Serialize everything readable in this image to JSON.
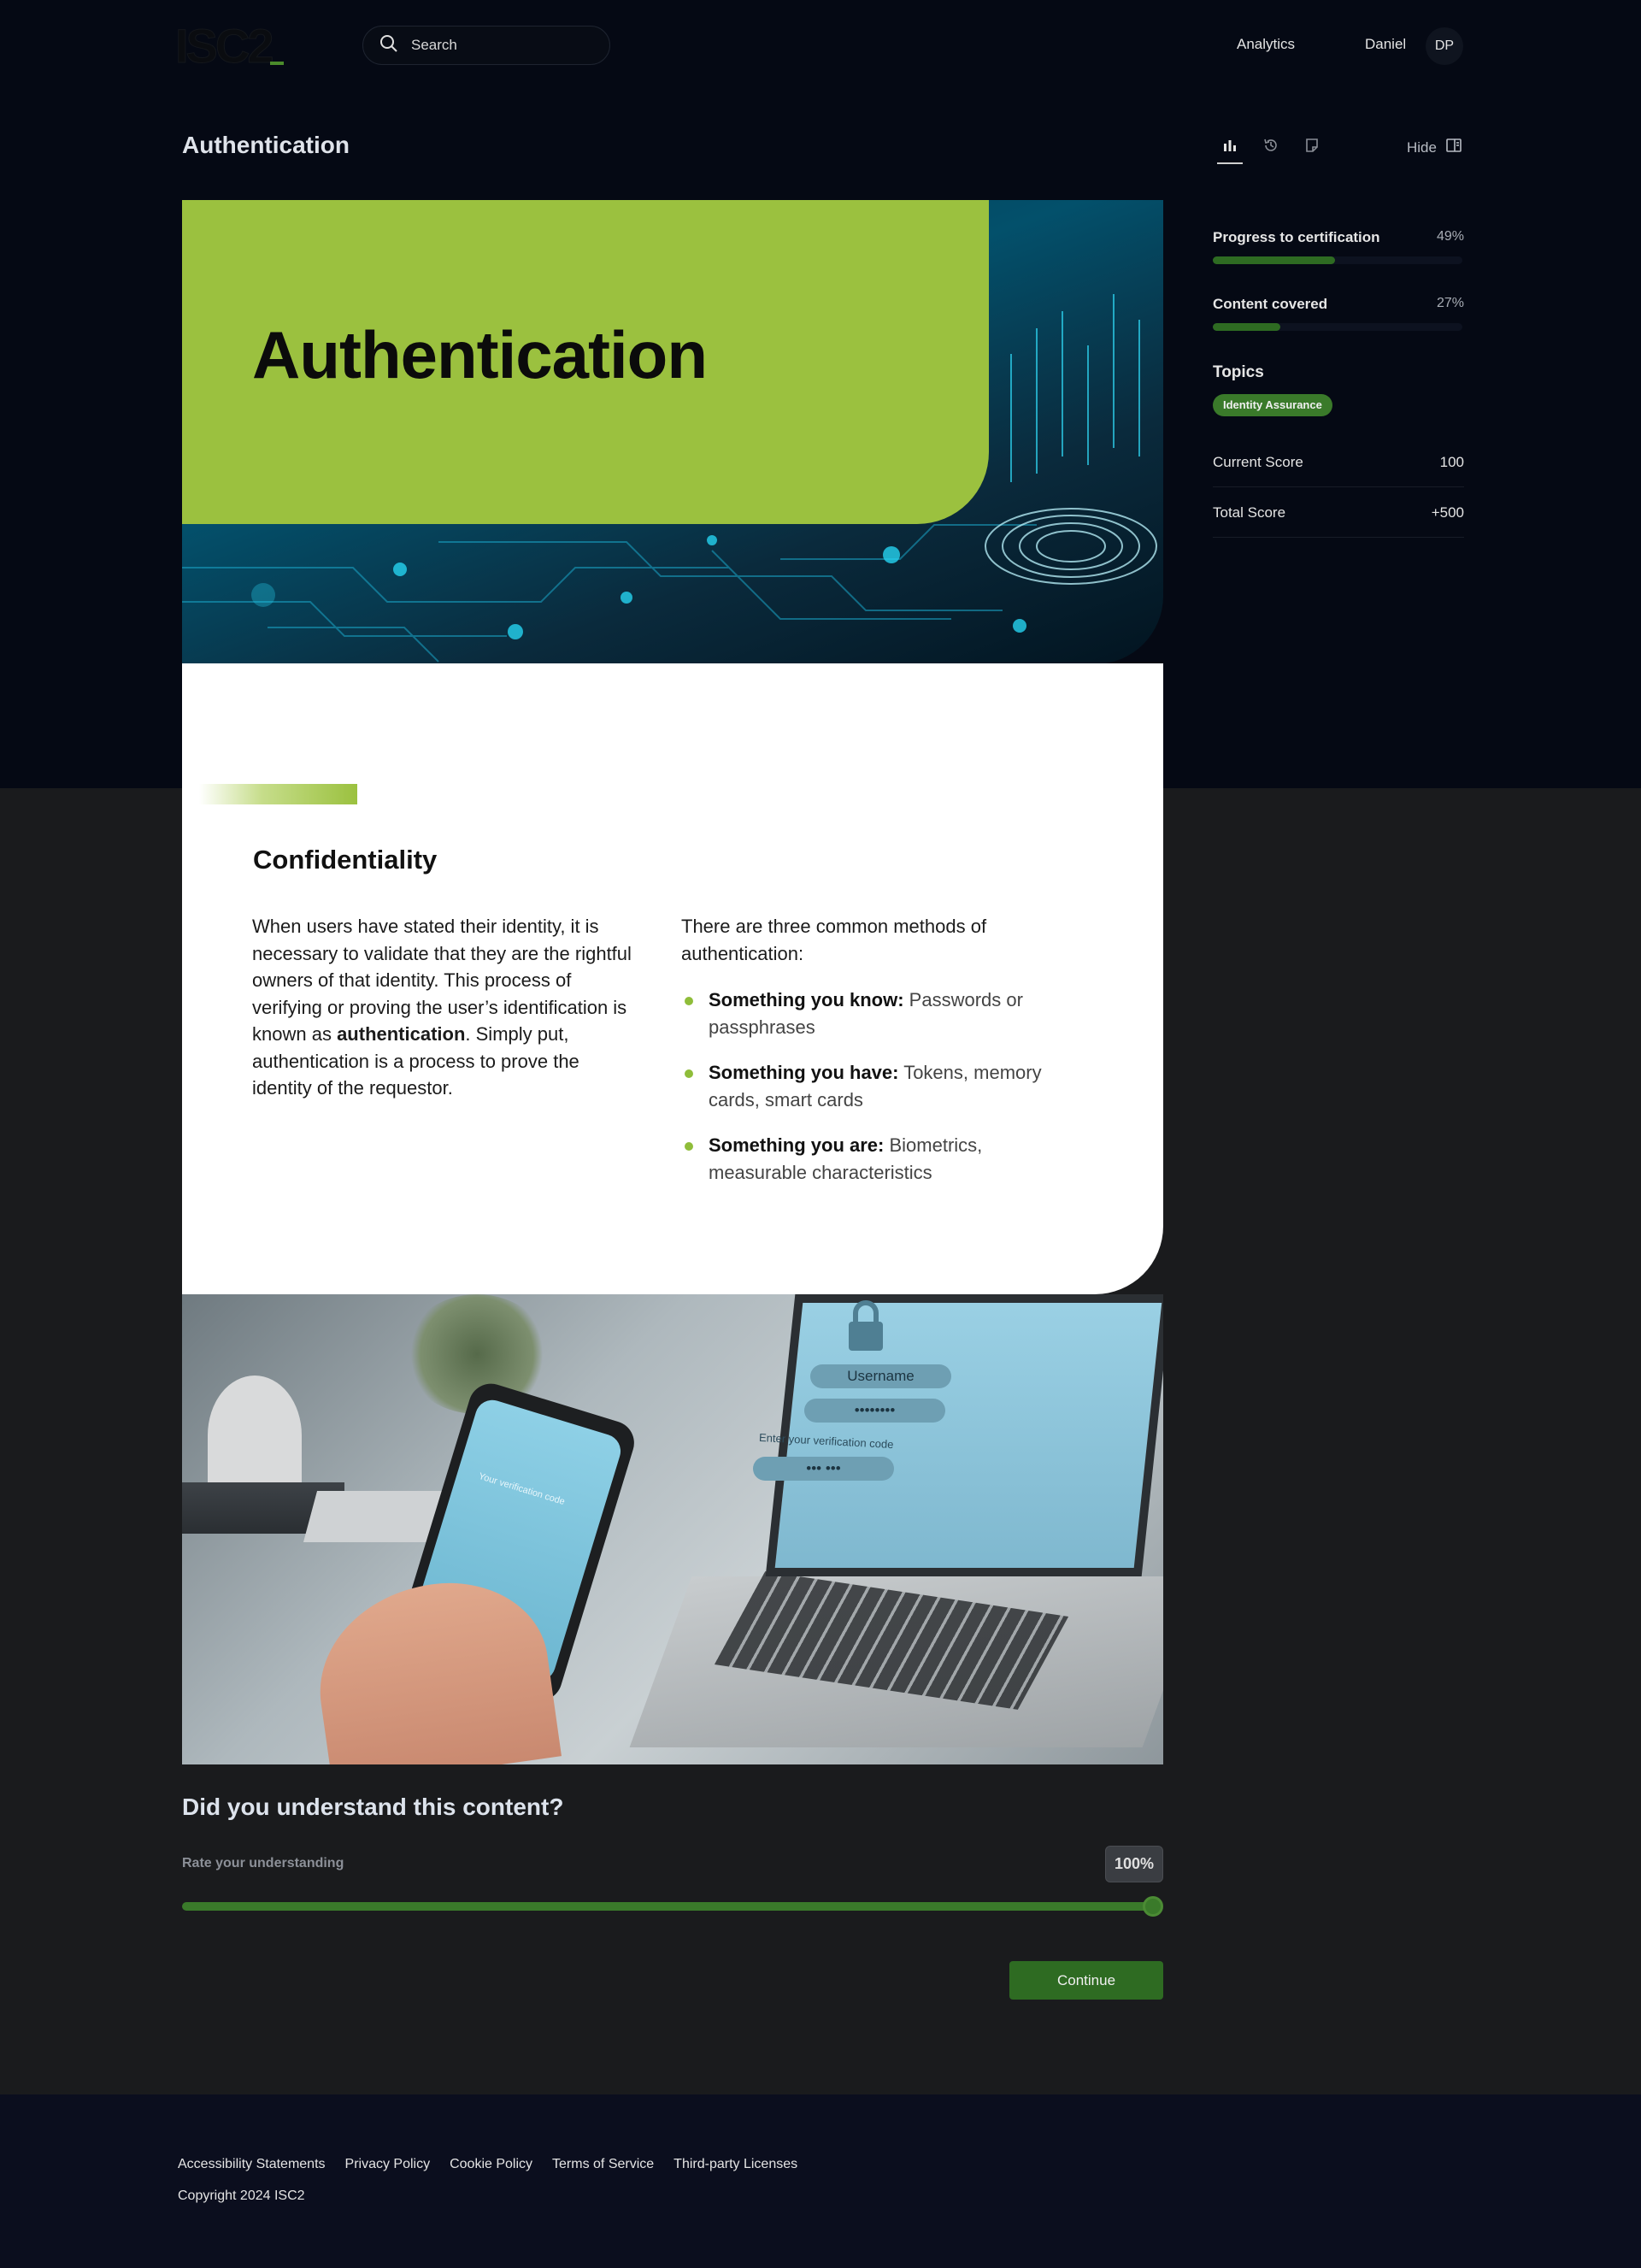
{
  "header": {
    "logo": "ISC2",
    "search_placeholder": "Search",
    "nav_analytics": "Analytics",
    "user_name": "Daniel",
    "user_initials": "DP"
  },
  "page": {
    "title": "Authentication",
    "hide_label": "Hide"
  },
  "sidebar": {
    "progress_label": "Progress to certification",
    "progress_value": "49%",
    "progress_fraction": 0.49,
    "content_label": "Content covered",
    "content_value": "27%",
    "content_fraction": 0.27,
    "topics_title": "Topics",
    "topic_chip": "Identity Assurance",
    "current_score_label": "Current Score",
    "current_score_value": "100",
    "total_score_label": "Total Score",
    "total_score_value": "+500"
  },
  "hero": {
    "title": "Authentication"
  },
  "content": {
    "section_title": "Confidentiality",
    "left_text_before": "When users have stated their identity, it is necessary to validate that they are the rightful owners of that identity. This process of verifying or proving the user’s identification is known as ",
    "left_text_bold": "authentication",
    "left_text_after": ". Simply put, authentication is a process to prove the identity of the requestor.",
    "right_intro": "There are three common methods of authentication:",
    "methods": [
      {
        "bold": "Something you know:",
        "text": " Passwords or passphrases"
      },
      {
        "bold": "Something you have:",
        "text": " Tokens, memory cards, smart cards"
      },
      {
        "bold": "Something you are:",
        "text": " Biometrics, measurable characteristics"
      }
    ]
  },
  "photo": {
    "username_field": "Username",
    "password_field": "••••••••",
    "verification_caption": "Enter your verification code",
    "code_field": "•••  •••",
    "phone_text": "Your verification code"
  },
  "rating": {
    "title": "Did you understand this content?",
    "label": "Rate your understanding",
    "value_text": "100%",
    "value_fraction": 1.0,
    "continue_label": "Continue"
  },
  "footer": {
    "links": [
      "Accessibility Statements",
      "Privacy Policy",
      "Cookie Policy",
      "Terms of Service",
      "Third-party Licenses"
    ],
    "copyright": "Copyright 2024 ISC2"
  },
  "colors": {
    "accent_green": "#9bc13f",
    "progress_green": "#2e6b22",
    "top_band": "#050914",
    "footer_bg": "#0b0e1e"
  }
}
